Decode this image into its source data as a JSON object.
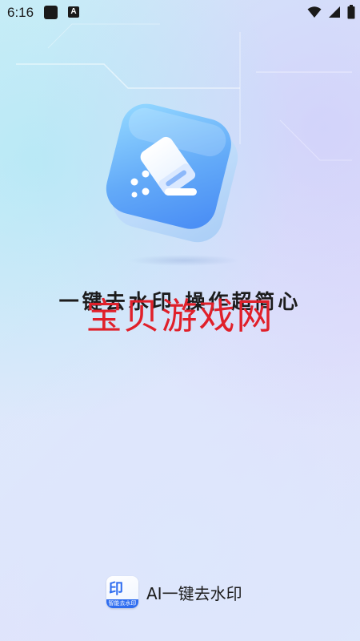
{
  "status_bar": {
    "time": "6:16",
    "icons": [
      "square-notification-icon",
      "a-notification-icon",
      "wifi-icon",
      "signal-icon",
      "battery-icon"
    ]
  },
  "hero": {
    "icon": "eraser-app-icon",
    "colors": {
      "tile_top": "#8fd4ff",
      "tile_bottom": "#4b8ff5",
      "eraser": "#ffffff"
    }
  },
  "slogan": "一键去水印 操作超简心",
  "watermark": "宝贝游戏网",
  "brand": {
    "logo_text": "印",
    "logo_band": "智能去水印",
    "name": "AI一键去水印"
  },
  "colors": {
    "accent": "#2f6df0",
    "watermark": "#e0202a",
    "text": "#1c1c1c"
  }
}
